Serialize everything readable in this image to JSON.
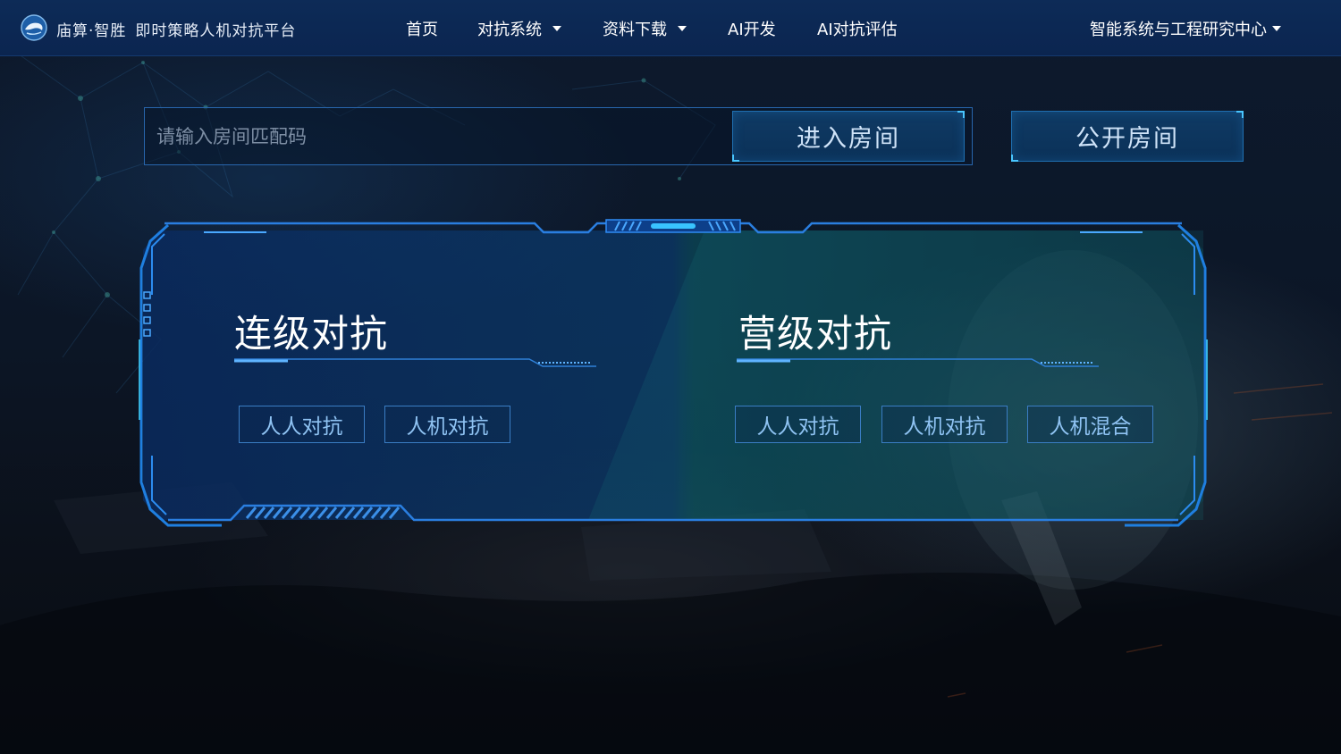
{
  "header": {
    "brand_name": "庙算·智胜",
    "brand_subtitle": "即时策略人机对抗平台",
    "nav": [
      {
        "label": "首页",
        "has_dropdown": false
      },
      {
        "label": "对抗系统",
        "has_dropdown": true
      },
      {
        "label": "资料下载",
        "has_dropdown": true
      },
      {
        "label": "AI开发",
        "has_dropdown": false
      },
      {
        "label": "AI对抗评估",
        "has_dropdown": false
      }
    ],
    "org_menu": {
      "label": "智能系统与工程研究中心",
      "has_dropdown": true
    }
  },
  "room": {
    "match_code_placeholder": "请输入房间匹配码",
    "match_code_value": "",
    "enter_label": "进入房间",
    "public_label": "公开房间"
  },
  "modes": [
    {
      "title": "连级对抗",
      "options": [
        "人人对抗",
        "人机对抗"
      ]
    },
    {
      "title": "营级对抗",
      "options": [
        "人人对抗",
        "人机对抗",
        "人机混合"
      ]
    }
  ],
  "icons": {
    "logo": "logo-swirl-icon",
    "dropdown": "caret-down-icon"
  },
  "colors": {
    "header_bg": "#0b2550",
    "accent_cyan": "#49c6ff",
    "frame_blue": "#1f7fe0",
    "button_text": "#8fc3f3",
    "primary_button_bg": "#0f3a64"
  }
}
